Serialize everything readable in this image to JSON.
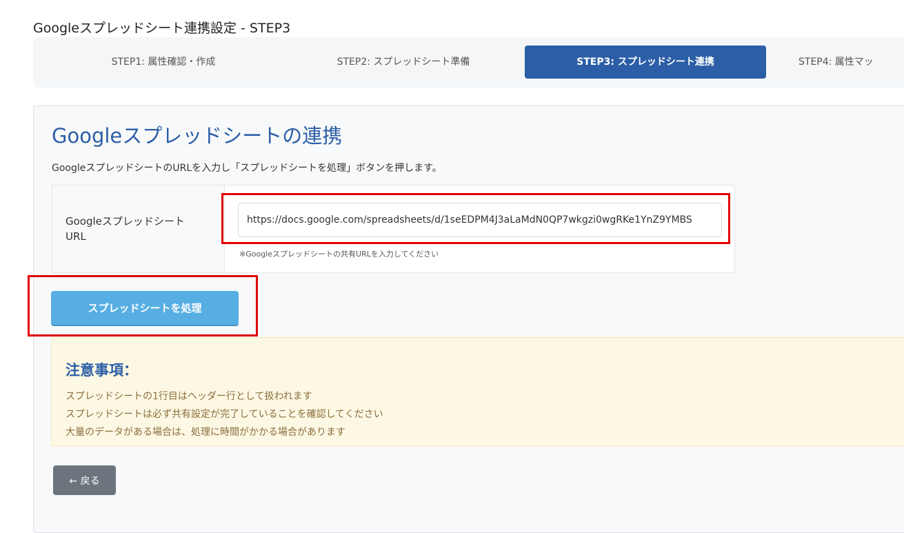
{
  "page": {
    "title": "Googleスプレッドシート連携設定 - STEP3"
  },
  "steps": [
    {
      "label": "STEP1: 属性確認・作成",
      "active": false
    },
    {
      "label": "STEP2: スプレッドシート準備",
      "active": false
    },
    {
      "label": "STEP3: スプレッドシート連携",
      "active": true
    },
    {
      "label": "STEP4: 属性マッ",
      "active": false
    }
  ],
  "panel": {
    "heading": "Googleスプレッドシートの連携",
    "description": "GoogleスプレッドシートのURLを入力し「スプレッドシートを処理」ボタンを押します。"
  },
  "form": {
    "url_label": "Googleスプレッドシート URL",
    "url_value": "https://docs.google.com/spreadsheets/d/1seEDPM4J3aLaMdN0QP7wkgzi0wgRKe1YnZ9YMBS",
    "url_hint": "※Googleスプレッドシートの共有URLを入力してください"
  },
  "actions": {
    "process_label": "スプレッドシートを処理",
    "back_label": "← 戻る"
  },
  "notice": {
    "title": "注意事項：",
    "items": [
      "スプレッドシートの1行目はヘッダー行として扱われます",
      "スプレッドシートは必ず共有設定が完了していることを確認してください",
      "大量のデータがある場合は、処理に時間がかかる場合があります"
    ]
  },
  "colors": {
    "primary": "#2b5ea7",
    "process_button": "#56aee3",
    "highlight": "#e00000",
    "notice_bg": "#fdf8e4",
    "notice_text": "#8a6d3b",
    "back_button": "#6c757d"
  }
}
